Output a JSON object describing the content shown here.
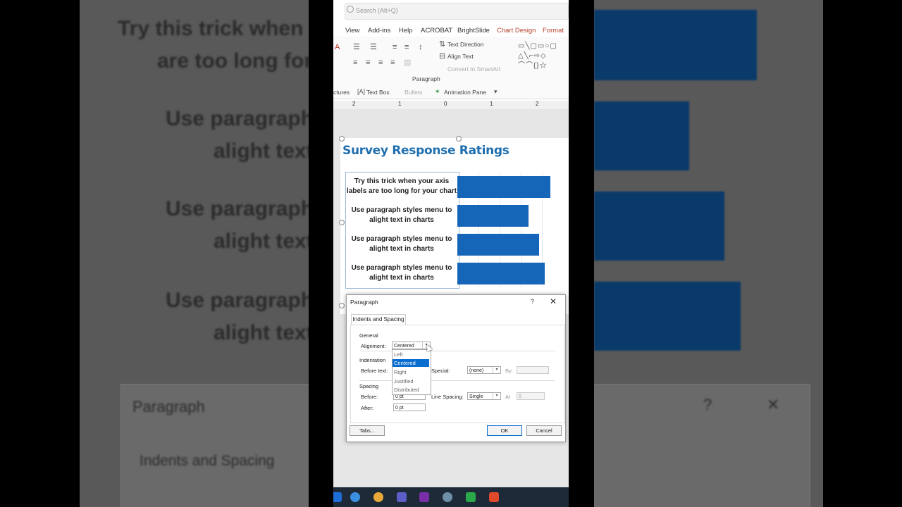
{
  "search": {
    "placeholder": "Search (Alt+Q)"
  },
  "ribbon_tabs": [
    "View",
    "Add-ins",
    "Help",
    "ACROBAT",
    "BrightSlide",
    "Chart Design",
    "Format"
  ],
  "ribbon": {
    "text_direction": "Text Direction",
    "align_text": "Align Text",
    "convert_smartart": "Convert to SmartArt",
    "paragraph_group": "Paragraph",
    "pictures": "ctures",
    "text_box": "Text Box",
    "bullets": "Bullets",
    "animation_pane": "Animation Pane"
  },
  "ruler": [
    "2",
    "1",
    "0",
    "1",
    "2"
  ],
  "chart": {
    "title": "Survey Response Ratings",
    "categories": [
      "Try this trick when your axis labels are too long for your chart",
      "Use paragraph styles menu to alight text in charts",
      "Use paragraph styles menu to alight text in charts",
      "Use paragraph styles menu to alight text in charts"
    ]
  },
  "chart_data": {
    "type": "bar",
    "title": "Survey Response Ratings",
    "orientation": "horizontal",
    "categories": [
      "Try this trick when your axis labels are too long for your chart",
      "Use paragraph styles menu to alight text in charts",
      "Use paragraph styles menu to alight text in charts",
      "Use paragraph styles menu to alight text in charts"
    ],
    "values": [
      0.85,
      0.65,
      0.75,
      0.8
    ],
    "color": "#1565b8",
    "grid": true
  },
  "dialog": {
    "title": "Paragraph",
    "help": "?",
    "close": "✕",
    "tab": "Indents and Spacing",
    "general": "General",
    "alignment_label": "Alignment:",
    "alignment_value": "Centered",
    "alignment_options": [
      "Left",
      "Centered",
      "Right",
      "Justified",
      "Distributed"
    ],
    "indentation": "Indentation",
    "before_text": "Before text:",
    "special": "Special:",
    "special_value": "(none)",
    "by": "By:",
    "spacing": "Spacing",
    "before": "Before:",
    "before_value": "0 pt",
    "after": "After:",
    "after_value": "0 pt",
    "line_spacing": "Line Spacing:",
    "line_spacing_value": "Single",
    "at": "At",
    "at_value": "0",
    "tabs_button": "Tabs...",
    "ok_button": "OK",
    "cancel_button": "Cancel"
  },
  "background": {
    "lines": [
      "Try this trick when y",
      "are too long for",
      "Use paragraph s",
      "alight text",
      "Use paragraph s",
      "alight text",
      "Use paragraph s",
      "alight text"
    ],
    "dialog_title": "Paragraph",
    "dialog_tab": "Indents and Spacing",
    "help": "?",
    "close": "✕"
  },
  "colors": {
    "accent_tab": "#b5402a",
    "chart_title": "#1f6fb0",
    "bar": "#1565b8",
    "selection": "#0a6ed1"
  }
}
